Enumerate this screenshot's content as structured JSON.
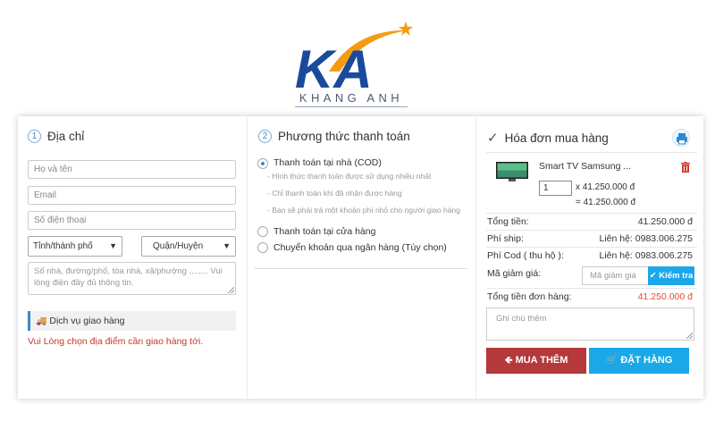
{
  "logo": {
    "brand_text": "KHANG ANH",
    "letters": "KA"
  },
  "address": {
    "step": "1",
    "title": "Địa chỉ",
    "name_placeholder": "Họ và tên",
    "email_placeholder": "Email",
    "phone_placeholder": "Số điện thoại",
    "province_select": "Tỉnh/thành phố",
    "district_select": "Quận/Huyện",
    "address_placeholder": "Số nhà, đường/phố, tòa nhà, xã/phường ,....... Vui lòng điền đầy đủ thông tin.",
    "shipping_service_label": "Dịch vụ giao hàng",
    "shipping_warning": "Vui Lòng chọn địa điểm cần giao hàng tới."
  },
  "payment": {
    "step": "2",
    "title": "Phương thức thanh toán",
    "options": [
      {
        "label": "Thanh toán tại nhà (COD)",
        "selected": true,
        "notes": [
          "- Hình thức thanh toán được sử dụng nhiều nhất",
          "- Chỉ thanh toán khi đã nhận được hàng",
          "- Bạn sẽ phải trả một khoản phí nhỏ cho người giao hàng"
        ]
      },
      {
        "label": "Thanh toán tại cửa hàng",
        "selected": false
      },
      {
        "label": "Chuyển khoản qua ngân hàng (Tùy chọn)",
        "selected": false
      }
    ]
  },
  "invoice": {
    "title": "Hóa đơn mua hàng",
    "product_name": "Smart TV Samsung ...",
    "quantity": "1",
    "unit_price": "x 41.250.000 đ",
    "line_total": "= 41.250.000 đ",
    "subtotal_label": "Tổng tiền:",
    "subtotal_value": "41.250.000 đ",
    "shipping_label": "Phí ship:",
    "shipping_value": "Liên hệ: 0983.006.275",
    "cod_label": "Phí Cod ( thu hộ ):",
    "cod_value": "Liên hệ: 0983.006.275",
    "coupon_label": "Mã giảm giá:",
    "coupon_placeholder": "Mã giảm giá",
    "check_button": "Kiểm tra",
    "total_label": "Tổng tiền đơn hàng:",
    "total_value": "41.250.000 đ",
    "note_placeholder": "Ghi chú thêm",
    "buy_more_button": "MUA THÊM",
    "order_button": "ĐẶT HÀNG"
  },
  "colors": {
    "accent_blue": "#1aa8e8",
    "buy_more_red": "#b5383a",
    "total_red": "#e44b2b",
    "logo_blue": "#1a4a9c",
    "logo_orange": "#f39c12"
  }
}
